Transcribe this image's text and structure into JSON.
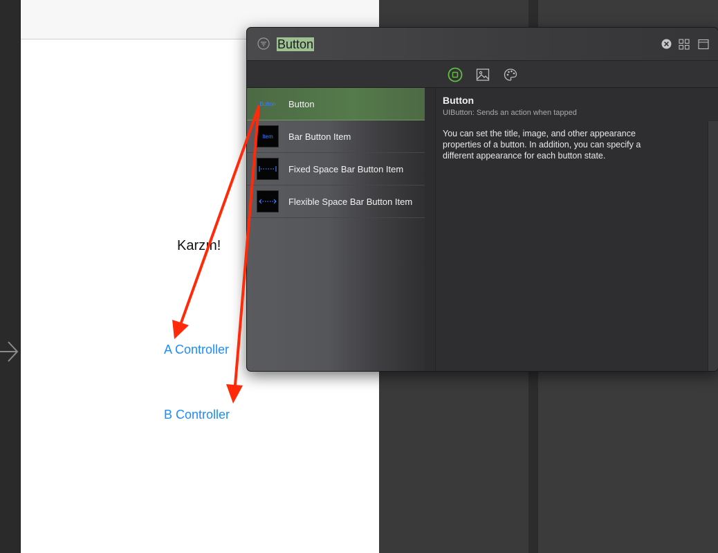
{
  "canvas": {
    "scene": {
      "label_text": "Karzın!",
      "buttons": [
        "A Controller",
        "B Controller"
      ]
    }
  },
  "library": {
    "search": {
      "value": "Button"
    },
    "tabs": [
      "objects-icon",
      "media-icon",
      "colors-icon"
    ],
    "items": [
      {
        "label": "Button",
        "thumb": "Button",
        "selected": true
      },
      {
        "label": "Bar Button Item",
        "thumb": "Item"
      },
      {
        "label": "Fixed Space Bar Button Item",
        "thumb": "fixed-space-icon"
      },
      {
        "label": "Flexible Space Bar Button Item",
        "thumb": "flexible-space-icon"
      }
    ],
    "detail": {
      "title": "Button",
      "subtitle": "UIButton: Sends an action when tapped",
      "description": "You can set the title, image, and other appearance properties of a button. In addition, you can specify a different appearance for each button state."
    }
  },
  "colors": {
    "accent_green": "#5fbf3f",
    "link_blue": "#1a8cff",
    "annotation_red": "#ff2a0a",
    "selection_green": "#557a4b"
  }
}
